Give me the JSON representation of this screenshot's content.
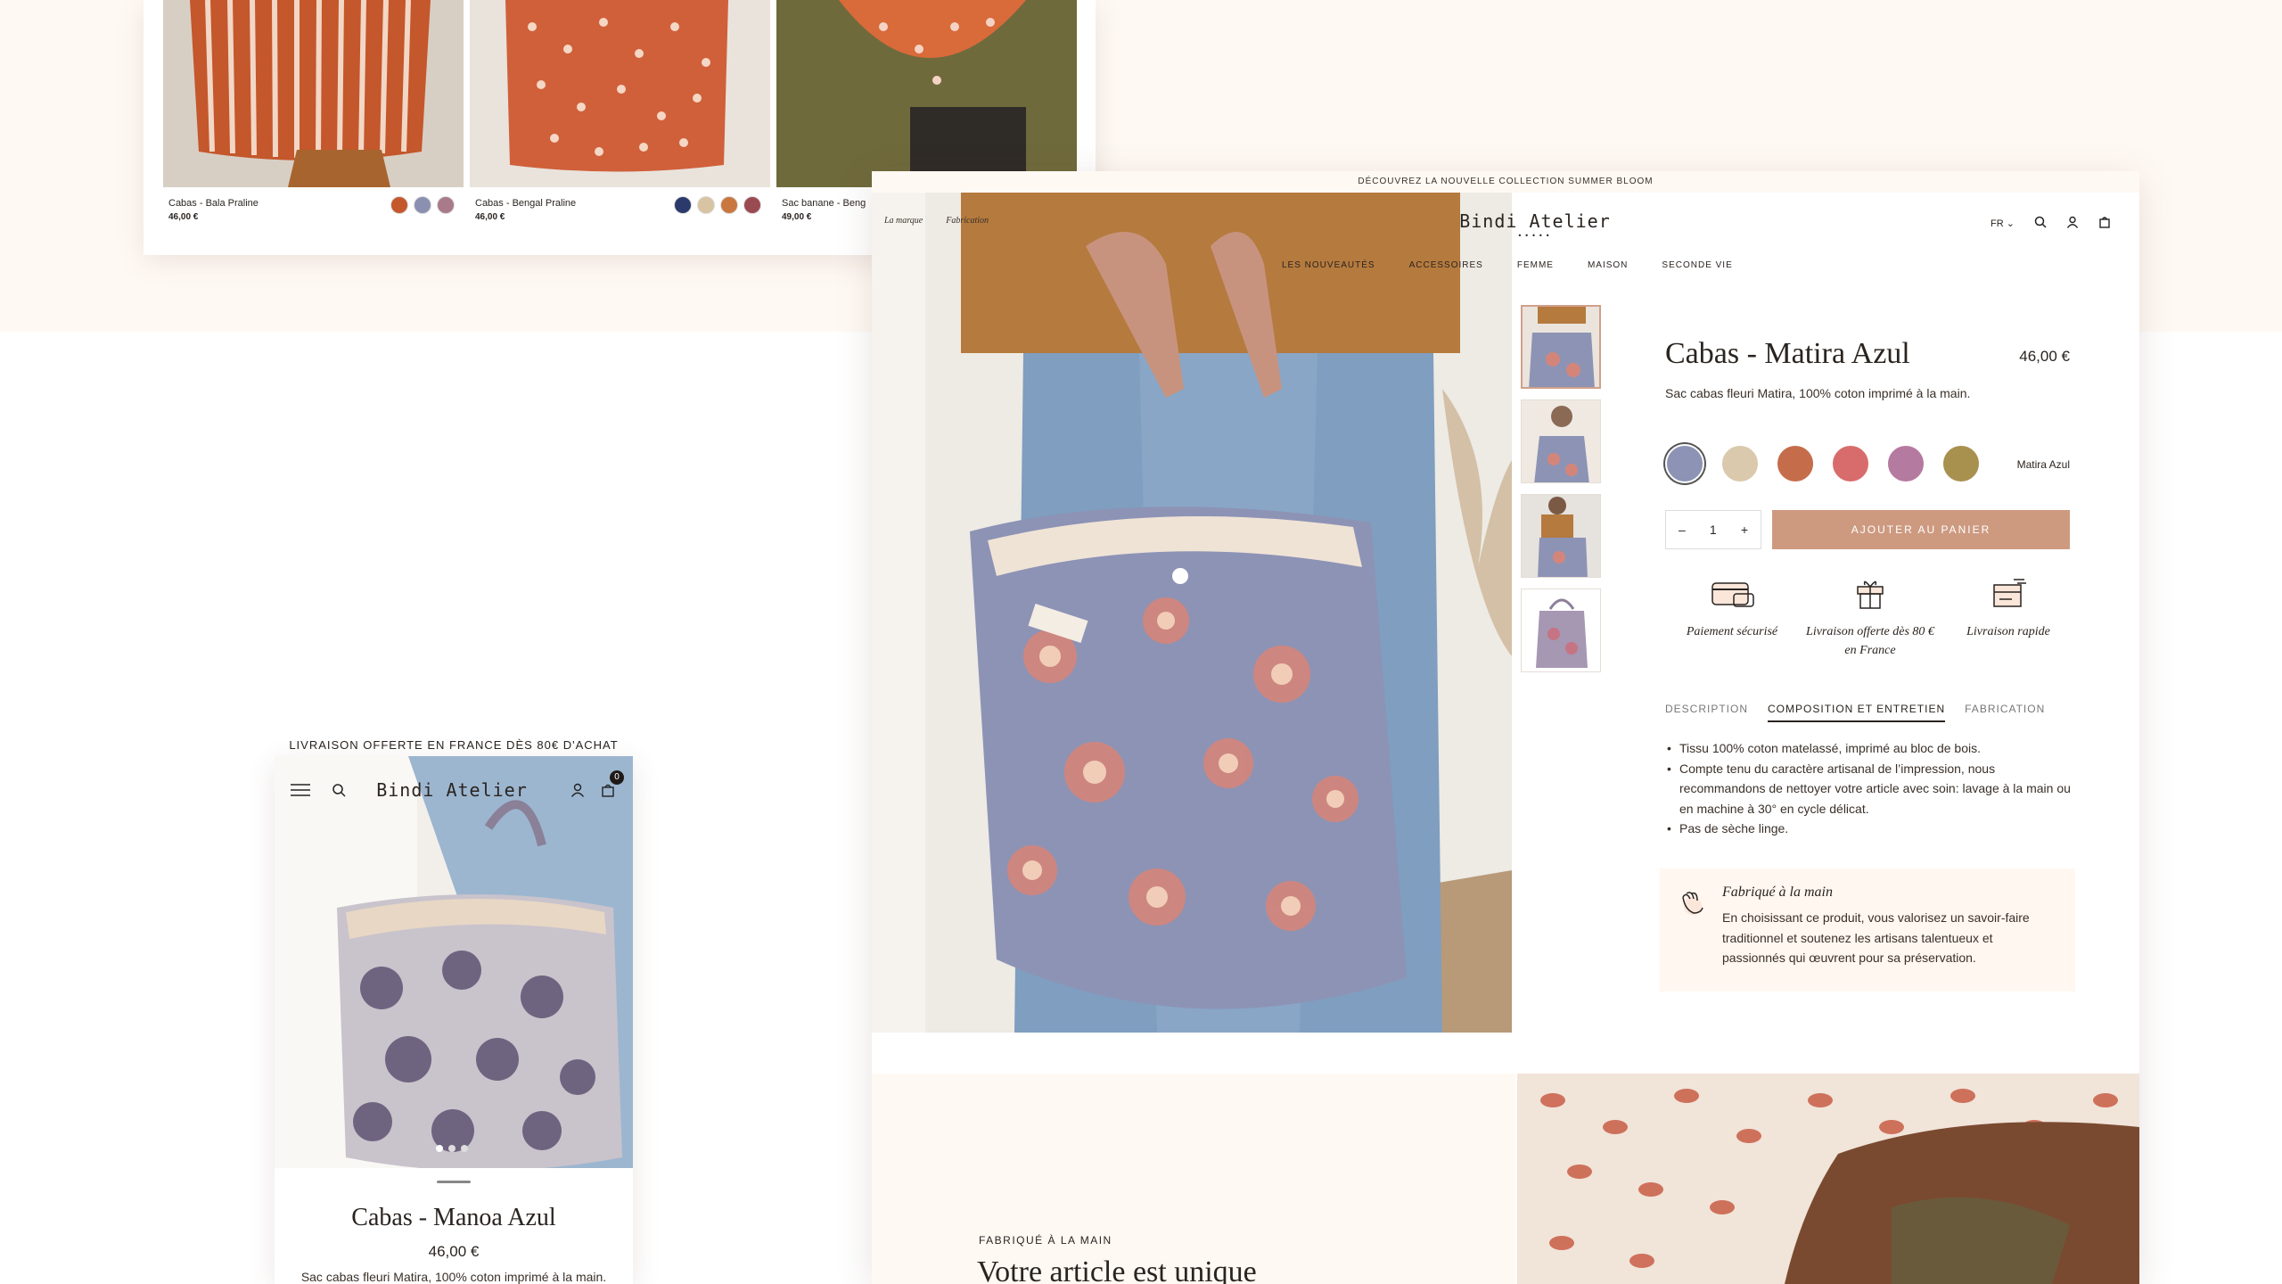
{
  "listing": {
    "items": [
      {
        "name": "Cabas - Bala Praline",
        "price": "46,00 €"
      },
      {
        "name": "Cabas - Bengal Praline",
        "price": "46,00 €"
      },
      {
        "name": "Sac banane - Beng",
        "price": "49,00 €"
      }
    ]
  },
  "desktop": {
    "announcement": "DÉCOUVREZ LA NOUVELLE COLLECTION SUMMER BLOOM",
    "nav_left": [
      "La marque",
      "Fabrication"
    ],
    "logo": "Bindi Atelier",
    "language": "FR",
    "nav_main": [
      "LES NOUVEAUTÉS",
      "ACCESSOIRES",
      "FEMME",
      "MAISON",
      "SECONDE VIE"
    ],
    "product": {
      "title": "Cabas - Matira Azul",
      "price": "46,00 €",
      "description": "Sac cabas fleuri Matira, 100% coton imprimé à la main.",
      "selected_variant": "Matira Azul",
      "quantity": "1",
      "qty_minus": "–",
      "qty_plus": "+",
      "add_to_cart": "AJOUTER AU PANIER"
    },
    "reassurance": [
      {
        "label": "Paiement sécurisé",
        "icon": "card-icon"
      },
      {
        "label": "Livraison offerte dès 80 € en France",
        "icon": "gift-icon"
      },
      {
        "label": "Livraison rapide",
        "icon": "fast-delivery-icon"
      }
    ],
    "tabs": [
      "DESCRIPTION",
      "COMPOSITION ET ENTRETIEN",
      "FABRICATION"
    ],
    "active_tab": "COMPOSITION ET ENTRETIEN",
    "composition": [
      "Tissu 100% coton matelassé, imprimé au bloc de bois.",
      "Compte tenu du caractère artisanal de l’impression, nous recommandons de nettoyer votre article avec soin: lavage à la main ou en machine à 30° en cycle délicat.",
      "Pas de sèche linge."
    ],
    "handmade": {
      "title": "Fabriqué à la main",
      "body": "En choisissant ce produit, vous valorisez un savoir-faire traditionnel et soutenez les artisans talentueux et passionnés qui œuvrent pour sa préservation."
    },
    "section": {
      "eyebrow": "FABRIQUÉ À LA MAIN",
      "title": "Votre article est unique"
    }
  },
  "mobile": {
    "announcement": "LIVRAISON OFFERTE EN FRANCE DÈS 80€ D'ACHAT",
    "logo": "Bindi Atelier",
    "cart_count": "0",
    "title": "Cabas - Manoa Azul",
    "price": "46,00 €",
    "description": "Sac cabas fleuri Matira, 100% coton imprimé à la main."
  },
  "colors": {
    "background_band": "#fff9f4",
    "accent_button": "#cd9a80",
    "text": "#2a2420"
  }
}
